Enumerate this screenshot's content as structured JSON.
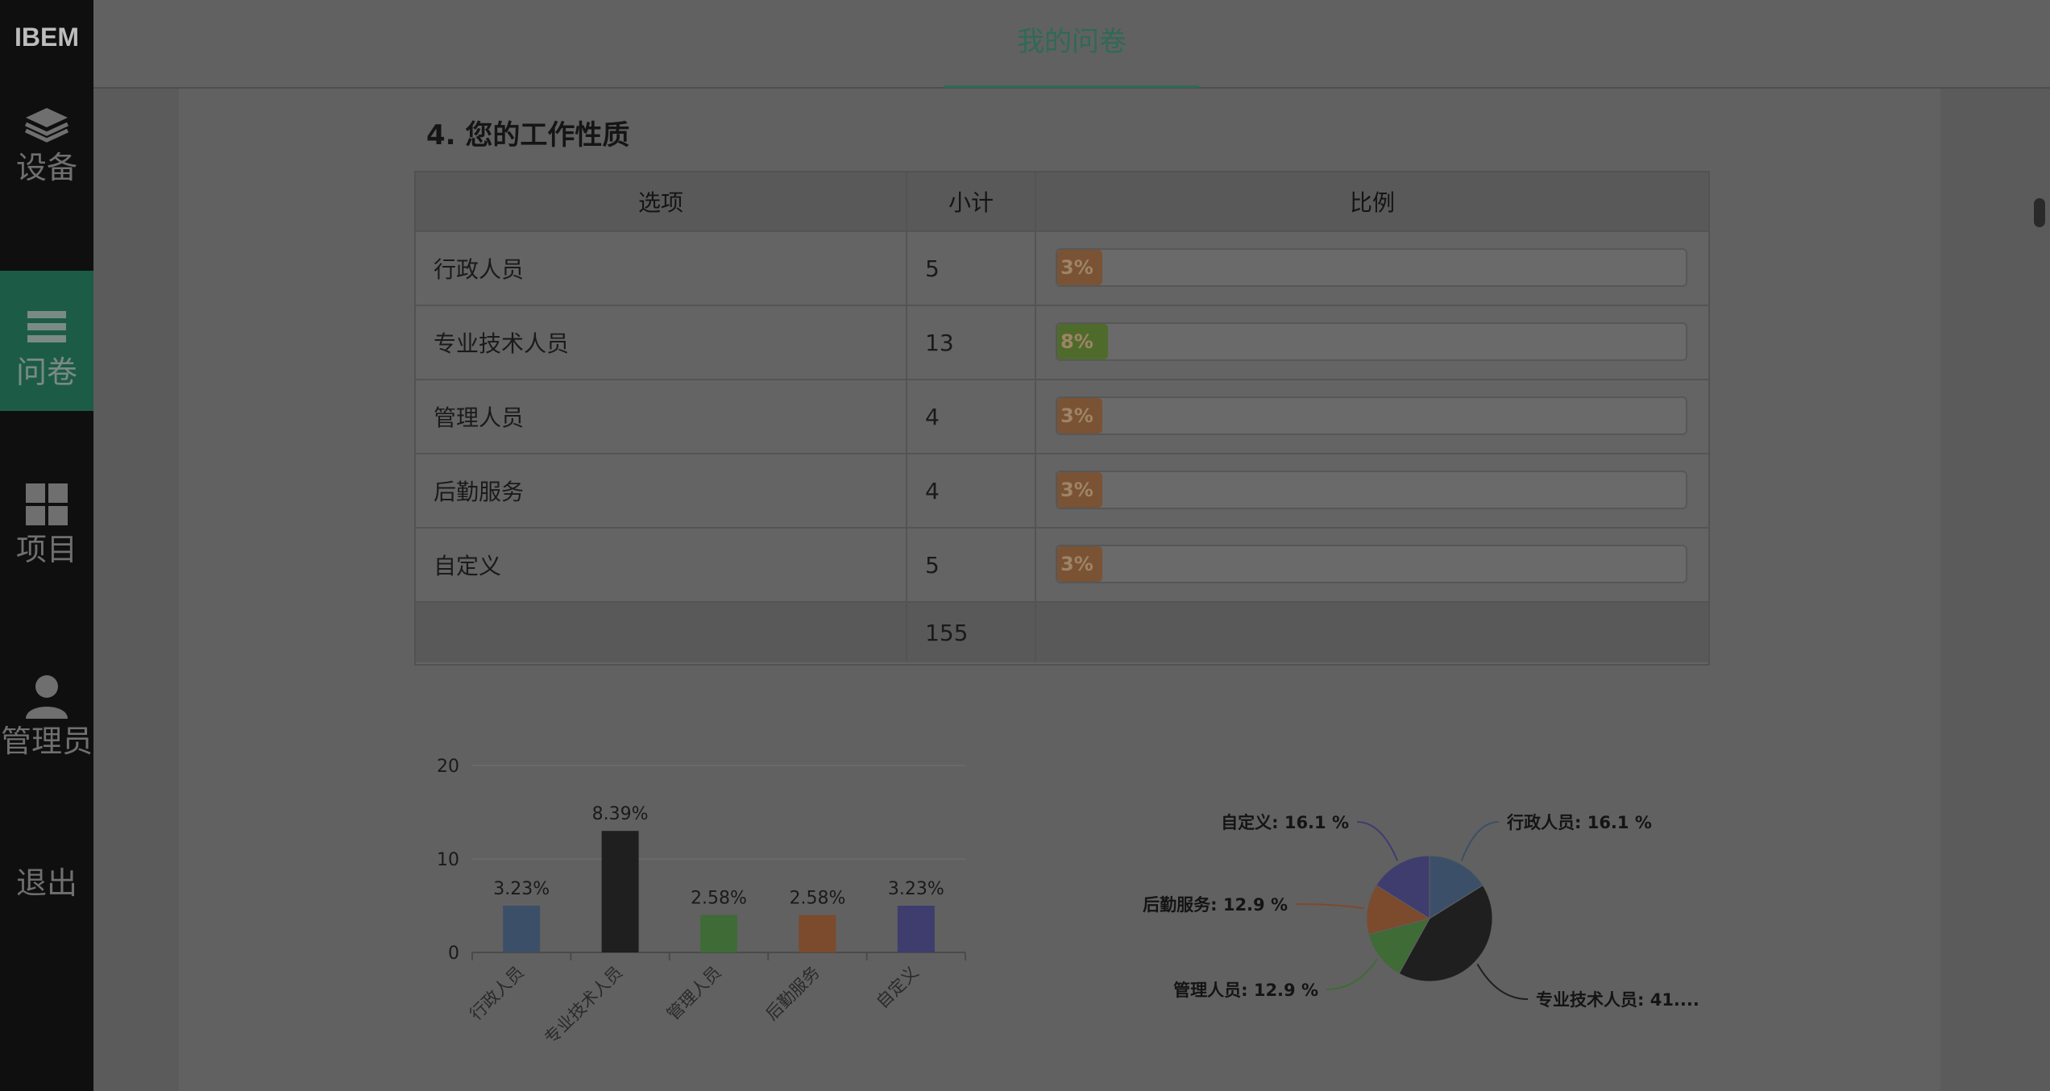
{
  "sidebar": {
    "brand": "IBEM",
    "items": [
      {
        "label": "设备",
        "icon": "layers-icon"
      },
      {
        "label": "问卷",
        "icon": "list-icon"
      },
      {
        "label": "项目",
        "icon": "grid-icon"
      },
      {
        "label": "管理员",
        "icon": "user-icon"
      },
      {
        "label": "退出",
        "icon": ""
      }
    ],
    "active": "问卷"
  },
  "topbar": {
    "tab_label": "我的问卷",
    "accent": "#2f6a55"
  },
  "question": {
    "title": "4. 您的工作性质",
    "columns": [
      "选项",
      "小计",
      "比例"
    ],
    "rows": [
      {
        "option": "行政人员",
        "count": "5",
        "percent_label": "3%",
        "fraction": 0.03,
        "color": "#7a5234"
      },
      {
        "option": "专业技术人员",
        "count": "13",
        "percent_label": "8%",
        "fraction": 0.08,
        "color": "#4f6b2c"
      },
      {
        "option": "管理人员",
        "count": "4",
        "percent_label": "3%",
        "fraction": 0.03,
        "color": "#7a5234"
      },
      {
        "option": "后勤服务",
        "count": "4",
        "percent_label": "3%",
        "fraction": 0.03,
        "color": "#7a5234"
      },
      {
        "option": "自定义",
        "count": "5",
        "percent_label": "3%",
        "fraction": 0.03,
        "color": "#7a5234"
      }
    ],
    "total": "155"
  },
  "chart_data": [
    {
      "type": "bar",
      "categories": [
        "行政人员",
        "专业技术人员",
        "管理人员",
        "后勤服务",
        "自定义"
      ],
      "values": [
        5,
        13,
        4,
        4,
        5
      ],
      "data_labels": [
        "3.23%",
        "8.39%",
        "2.58%",
        "2.58%",
        "3.23%"
      ],
      "colors": [
        "#3c4f68",
        "#1f1f1f",
        "#3f6b36",
        "#7c4a2c",
        "#3f3c6e"
      ],
      "yticks": [
        0,
        10,
        20
      ],
      "ylim": [
        0,
        20
      ],
      "grid": true
    },
    {
      "type": "pie",
      "slices": [
        {
          "name": "行政人员",
          "value": 16.1,
          "label": "行政人员: 16.1 %",
          "color": "#3c4f68"
        },
        {
          "name": "专业技术人员",
          "value": 41.9,
          "label": "专业技术人员: 41....",
          "color": "#1f1f1f"
        },
        {
          "name": "管理人员",
          "value": 12.9,
          "label": "管理人员: 12.9 %",
          "color": "#3f6b36"
        },
        {
          "name": "后勤服务",
          "value": 12.9,
          "label": "后勤服务: 12.9 %",
          "color": "#7c4a2c"
        },
        {
          "name": "自定义",
          "value": 16.1,
          "label": "自定义: 16.1 %",
          "color": "#3f3c6e"
        }
      ]
    }
  ]
}
